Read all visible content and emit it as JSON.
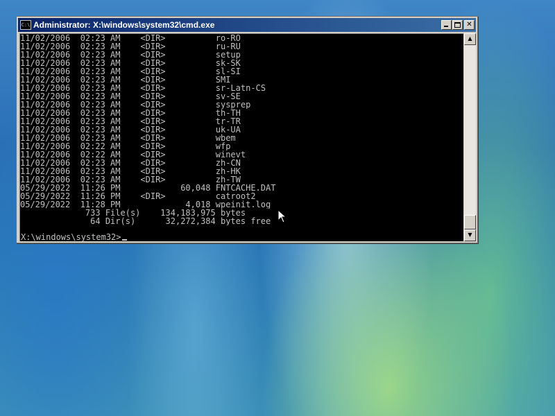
{
  "window": {
    "title": "Administrator: X:\\windows\\system32\\cmd.exe",
    "icon_text": "C:\\",
    "buttons": {
      "minimize": "minimize-icon",
      "maximize": "maximize-icon",
      "close": "✕"
    }
  },
  "console": {
    "lines": [
      "11/02/2006  02:23 AM    <DIR>          ro-RO",
      "11/02/2006  02:23 AM    <DIR>          ru-RU",
      "11/02/2006  02:23 AM    <DIR>          setup",
      "11/02/2006  02:23 AM    <DIR>          sk-SK",
      "11/02/2006  02:23 AM    <DIR>          sl-SI",
      "11/02/2006  02:23 AM    <DIR>          SMI",
      "11/02/2006  02:23 AM    <DIR>          sr-Latn-CS",
      "11/02/2006  02:23 AM    <DIR>          sv-SE",
      "11/02/2006  02:23 AM    <DIR>          sysprep",
      "11/02/2006  02:23 AM    <DIR>          th-TH",
      "11/02/2006  02:23 AM    <DIR>          tr-TR",
      "11/02/2006  02:23 AM    <DIR>          uk-UA",
      "11/02/2006  02:23 AM    <DIR>          wbem",
      "11/02/2006  02:22 AM    <DIR>          wfp",
      "11/02/2006  02:22 AM    <DIR>          winevt",
      "11/02/2006  02:23 AM    <DIR>          zh-CN",
      "11/02/2006  02:23 AM    <DIR>          zh-HK",
      "11/02/2006  02:23 AM    <DIR>          zh-TW",
      "05/29/2022  11:26 PM            60,048 FNTCACHE.DAT",
      "05/29/2022  11:26 PM    <DIR>          catroot2",
      "05/29/2022  11:28 PM             4,018 wpeinit.log",
      "             733 File(s)    134,183,975 bytes",
      "              64 Dir(s)      32,272,384 bytes free"
    ],
    "prompt": "X:\\windows\\system32>"
  },
  "scrollbar": {
    "up_arrow": "▲",
    "down_arrow": "▼"
  },
  "colors": {
    "console_bg": "#000000",
    "console_fg": "#c0c0c0",
    "titlebar_start": "#0a246a",
    "titlebar_end": "#3a6ea5"
  }
}
